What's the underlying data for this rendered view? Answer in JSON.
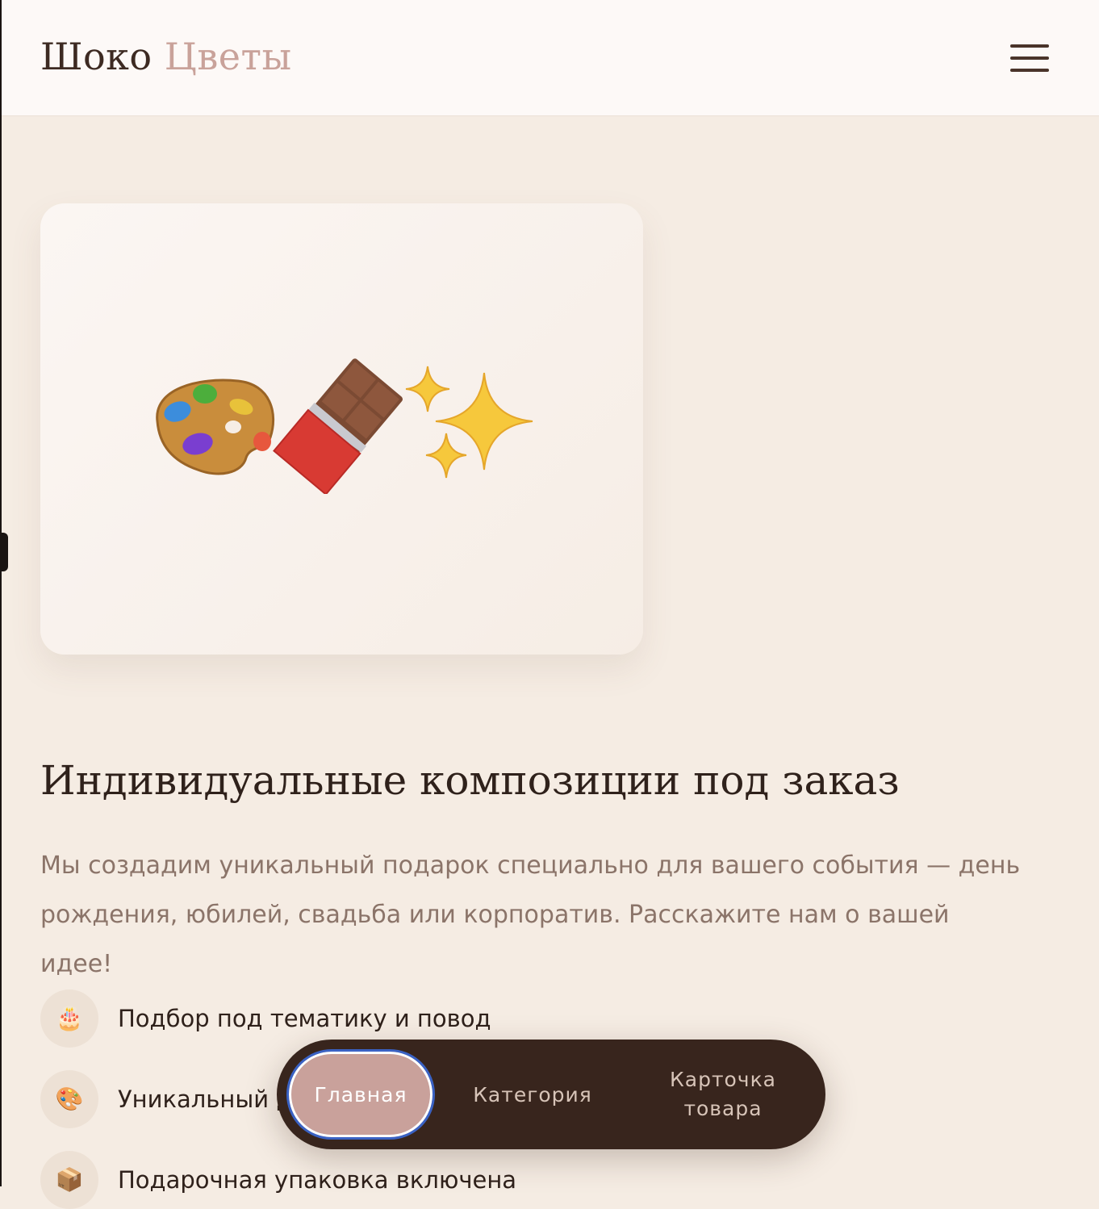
{
  "header": {
    "logo_main": "Шоко",
    "logo_accent": "Цветы",
    "menu_icon": "hamburger-menu-icon"
  },
  "hero": {
    "icons": [
      "palette-icon",
      "chocolate-bar-icon",
      "sparkles-icon"
    ]
  },
  "section": {
    "title": "Индивидуальные композиции под заказ",
    "description": "Мы создадим уникальный подарок специально для вашего события — день рождения, юбилей, свадьба или корпоратив. Расскажите нам о вашей идее!",
    "features": [
      {
        "icon": "🎂",
        "icon_name": "birthday-cake-icon",
        "label": "Подбор под тематику и повод"
      },
      {
        "icon": "🎨",
        "icon_name": "palette-icon",
        "label": "Уникальный д"
      },
      {
        "icon": "📦",
        "icon_name": "package-icon",
        "label": "Подарочная упаковка включена"
      }
    ]
  },
  "bottom_nav": {
    "home": "Главная",
    "category": "Категория",
    "product_line1": "Карточка",
    "product_line2": "товара",
    "active": "home"
  },
  "colors": {
    "background": "#f5ece3",
    "header_bg": "#fdf9f7",
    "accent": "#c9a29a",
    "nav_bg": "#38251d",
    "text_dark": "#2f211b",
    "text_muted": "#8b7469"
  }
}
